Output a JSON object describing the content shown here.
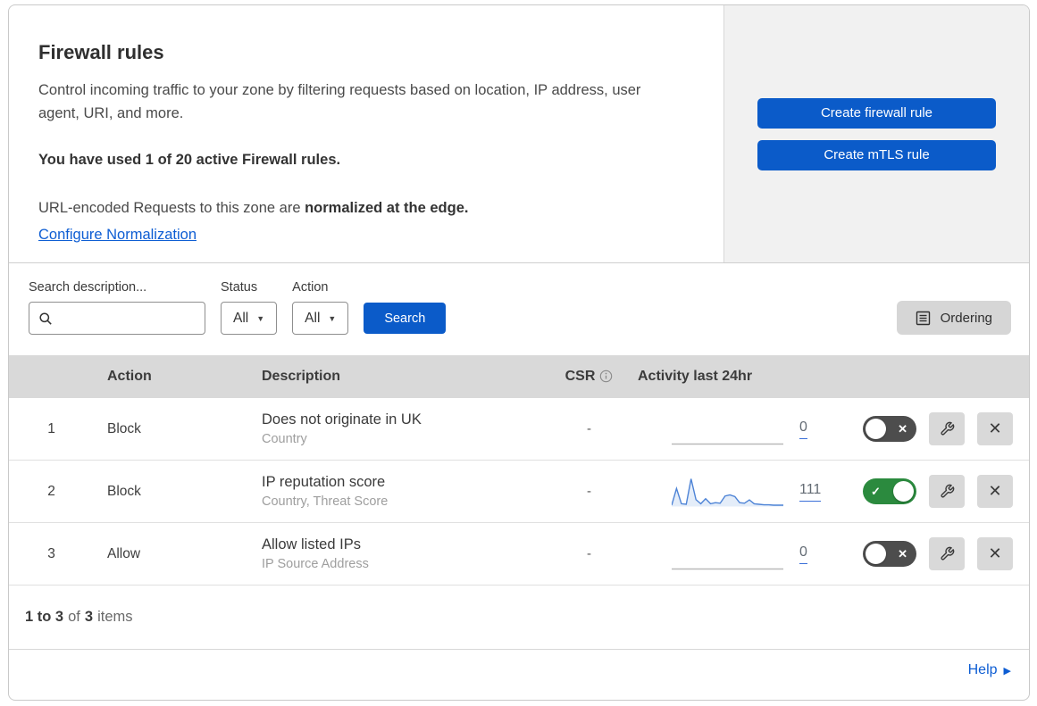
{
  "header": {
    "title": "Firewall rules",
    "description": "Control incoming traffic to your zone by filtering requests based on location, IP address, user agent, URI, and more.",
    "usage_notice": "You have used 1 of 20 active Firewall rules.",
    "normalization_prefix": "URL-encoded Requests to this zone are ",
    "normalization_bold": "normalized at the edge.",
    "normalization_link": "Configure Normalization",
    "buttons": {
      "create_firewall": "Create firewall rule",
      "create_mtls": "Create mTLS rule"
    }
  },
  "filters": {
    "search_label": "Search description...",
    "search_value": "",
    "status_label": "Status",
    "status_value": "All",
    "action_label": "Action",
    "action_value": "All",
    "search_button": "Search",
    "ordering_button": "Ordering"
  },
  "table": {
    "columns": {
      "action": "Action",
      "description": "Description",
      "csr": "CSR",
      "activity": "Activity last 24hr"
    },
    "rows": [
      {
        "index": "1",
        "action": "Block",
        "description": "Does not originate in UK",
        "fields": "Country",
        "csr": "-",
        "activity_count": "0",
        "enabled": false,
        "sparkline": [
          0,
          0,
          0,
          0,
          0,
          0,
          0,
          0,
          0,
          0,
          0,
          0,
          0,
          0,
          0,
          0,
          0,
          0,
          0,
          0,
          0,
          0,
          0,
          0
        ]
      },
      {
        "index": "2",
        "action": "Block",
        "description": "IP reputation score",
        "fields": "Country, Threat Score",
        "csr": "-",
        "activity_count": "111",
        "enabled": true,
        "sparkline": [
          5,
          65,
          10,
          8,
          100,
          25,
          10,
          28,
          10,
          14,
          12,
          38,
          42,
          36,
          14,
          12,
          24,
          10,
          8,
          6,
          6,
          5,
          5,
          5
        ]
      },
      {
        "index": "3",
        "action": "Allow",
        "description": "Allow listed IPs",
        "fields": "IP Source Address",
        "csr": "-",
        "activity_count": "0",
        "enabled": false,
        "sparkline": [
          0,
          0,
          0,
          0,
          0,
          0,
          0,
          0,
          0,
          0,
          0,
          0,
          0,
          0,
          0,
          0,
          0,
          0,
          0,
          0,
          0,
          0,
          0,
          0
        ]
      }
    ]
  },
  "footer": {
    "range_bold": "1 to 3",
    "of_text": "of",
    "total_bold": "3",
    "items_text": "items",
    "help_link": "Help"
  },
  "colors": {
    "accent_blue": "#0b5bc9",
    "link_blue": "#0d5dd3",
    "toggle_on_green": "#2b8a3e",
    "toggle_off_gray": "#4d4d4d",
    "sparkline_blue": "#4d83d6",
    "table_header_gray": "#d9d9d9",
    "panel_gray": "#f1f1f1",
    "icon_button_gray": "#d9d9d9"
  }
}
